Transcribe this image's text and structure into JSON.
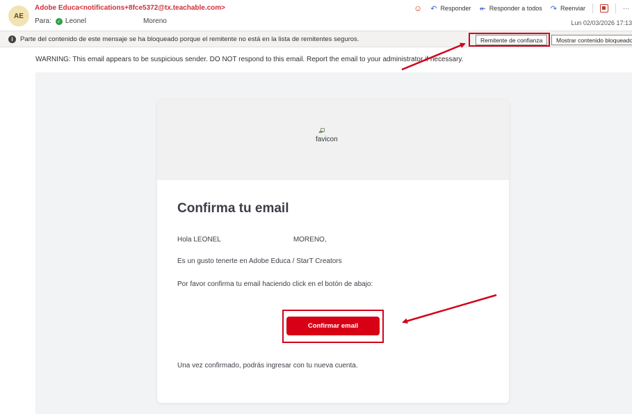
{
  "header": {
    "avatar_initials": "AE",
    "sender": "Adobe Educa<notifications+8fce5372@tx.teachable.com>",
    "to_label": "Para:",
    "to_first": "Leonel",
    "to_last": "Moreno",
    "actions": {
      "reply": "Responder",
      "reply_all": "Responder a todos",
      "forward": "Reenviar",
      "more": "···"
    },
    "date": "Lun 02/03/2026 17:13"
  },
  "blocked_bar": {
    "message": "Parte del contenido de este mensaje se ha bloqueado porque el remitente no está en la lista de remitentes seguros.",
    "trust_button": "Remitente de confianza",
    "show_button": "Mostrar contenido bloqueado"
  },
  "warning": "WARNING: This email appears to be suspicious sender. DO NOT respond to this email. Report the email to your administrator if necessary.",
  "email": {
    "logo_alt": "favicon",
    "title": "Confirma tu email",
    "greeting_first": "Hola LEONEL",
    "greeting_last": "MORENO,",
    "line2": "Es un gusto tenerte en Adobe Educa / StarT Creators",
    "line3": "Por favor confirma tu email haciendo click en el botón de abajo:",
    "button": "Confirmar email",
    "line4": "Una vez confirmado, podrás ingresar con tu nueva cuenta."
  },
  "colors": {
    "accent_red": "#d70015",
    "sender_red": "#d1303a",
    "annotation_red": "#d0021b"
  }
}
